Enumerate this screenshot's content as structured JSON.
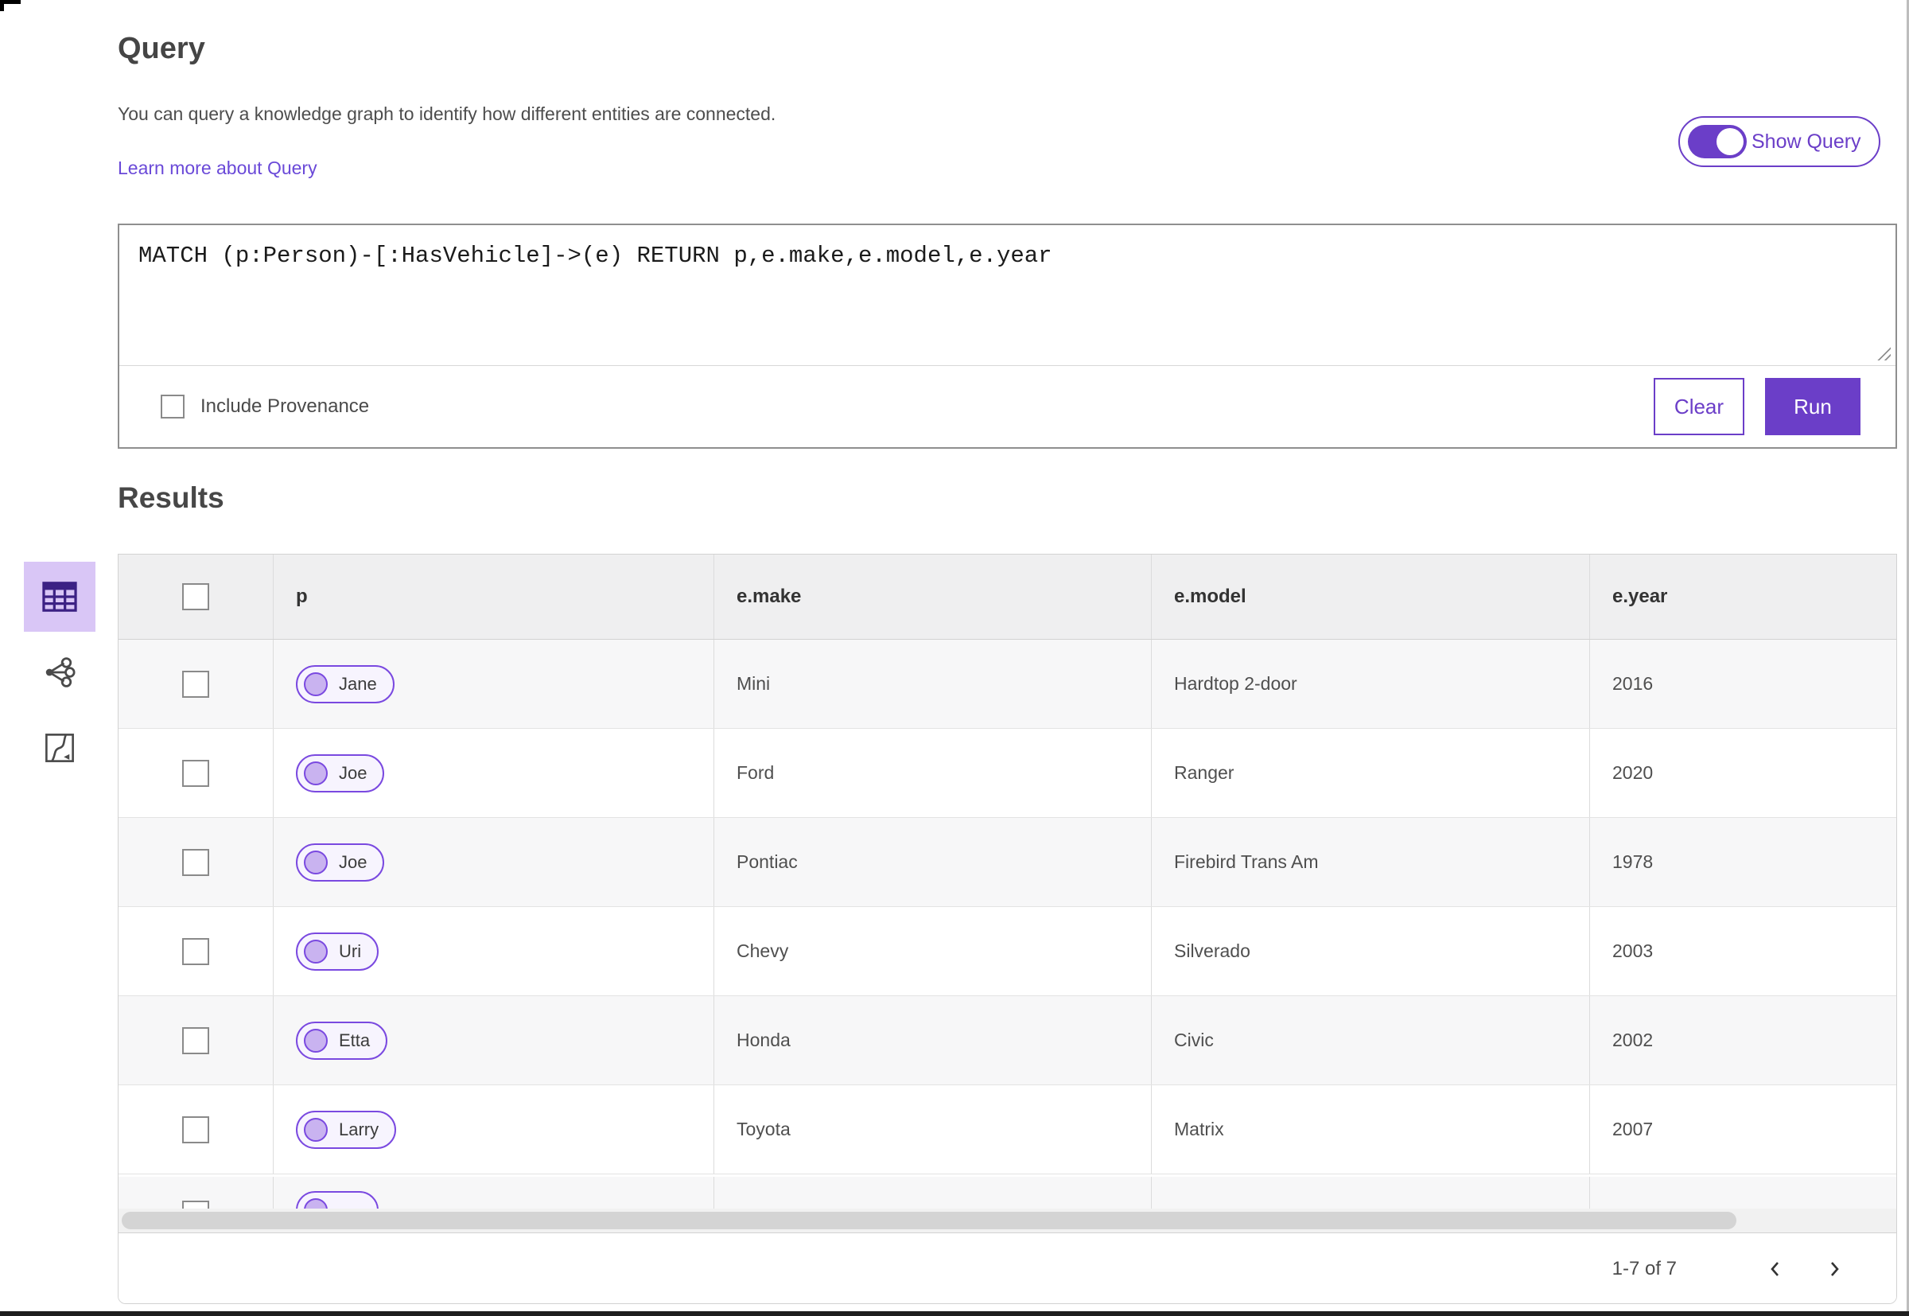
{
  "query_panel": {
    "title": "Query",
    "description": "You can query a knowledge graph to identify how different entities are connected.",
    "learn_more_label": "Learn more about Query",
    "show_query_label": "Show Query",
    "show_query_on": true,
    "query_text": "MATCH (p:Person)-[:HasVehicle]->(e) RETURN p,e.make,e.model,e.year",
    "include_provenance_label": "Include Provenance",
    "include_provenance_checked": false,
    "clear_label": "Clear",
    "run_label": "Run"
  },
  "view_switcher": {
    "items": [
      {
        "name": "table-view",
        "icon": "table-icon",
        "selected": true
      },
      {
        "name": "link-chart-view",
        "icon": "link-chart-icon",
        "selected": false
      },
      {
        "name": "map-view",
        "icon": "map-icon",
        "selected": false
      }
    ]
  },
  "results": {
    "title": "Results",
    "columns": {
      "c0": "p",
      "c1": "e.make",
      "c2": "e.model",
      "c3": "e.year"
    },
    "rows": [
      {
        "p": "Jane",
        "make": "Mini",
        "model": "Hardtop 2-door",
        "year": "2016"
      },
      {
        "p": "Joe",
        "make": "Ford",
        "model": "Ranger",
        "year": "2020"
      },
      {
        "p": "Joe",
        "make": "Pontiac",
        "model": "Firebird Trans Am",
        "year": "1978"
      },
      {
        "p": "Uri",
        "make": "Chevy",
        "model": "Silverado",
        "year": "2003"
      },
      {
        "p": "Etta",
        "make": "Honda",
        "model": "Civic",
        "year": "2002"
      },
      {
        "p": "Larry",
        "make": "Toyota",
        "model": "Matrix",
        "year": "2007"
      }
    ],
    "partial_seventh_row_visible": true,
    "pagination": {
      "range_label": "1-7 of 7"
    }
  },
  "colors": {
    "accent_purple": "#6b3ec8",
    "chip_border_purple": "#7a49e0",
    "chip_fill": "#f7f4fe",
    "chip_dot_fill": "#c9b3f0",
    "selected_tool_bg": "#d9c6f6",
    "link_purple": "#6a49d8",
    "header_bg": "#efeff0",
    "alt_row_bg": "#f7f7f8",
    "text_gray": "#4a4a4a"
  }
}
